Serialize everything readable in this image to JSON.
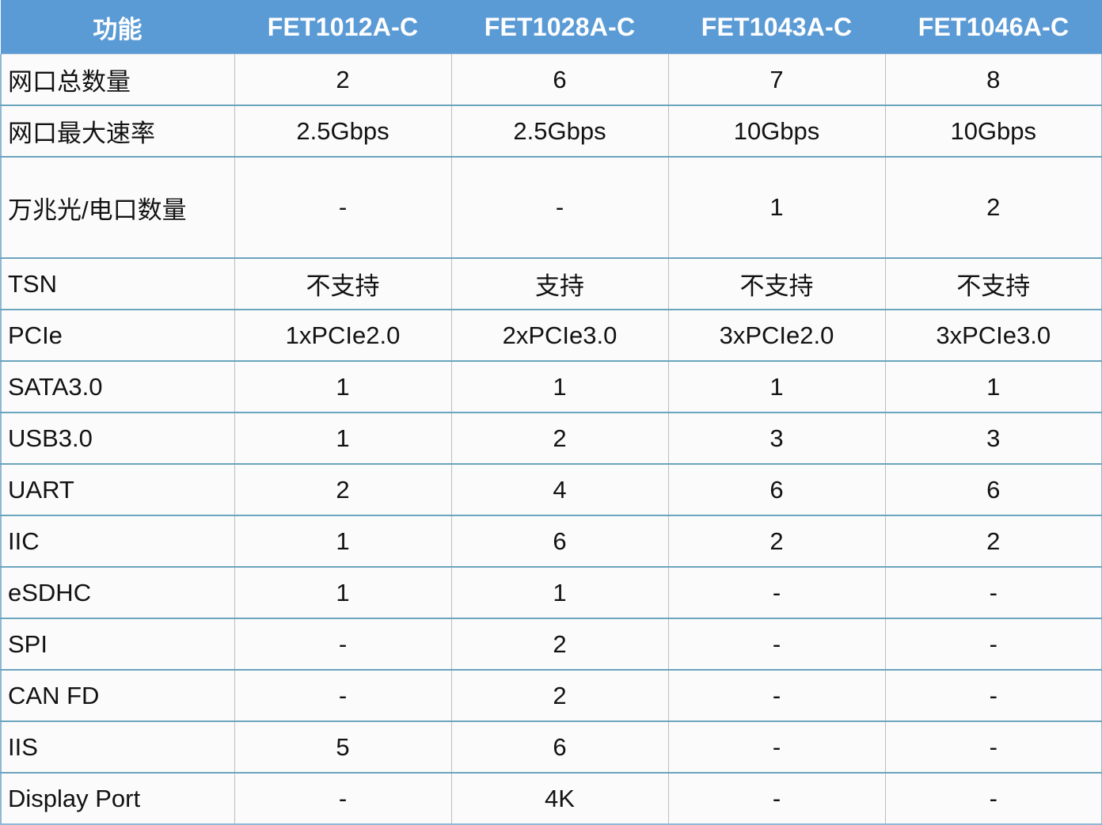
{
  "table": {
    "header": {
      "feature_label": "功能",
      "models": [
        "FET1012A-C",
        "FET1028A-C",
        "FET1043A-C",
        "FET1046A-C"
      ]
    },
    "rows": [
      {
        "feature": "网口总数量",
        "tall": false,
        "values": [
          "2",
          "6",
          "7",
          "8"
        ]
      },
      {
        "feature": "网口最大速率",
        "tall": false,
        "values": [
          "2.5Gbps",
          "2.5Gbps",
          "10Gbps",
          "10Gbps"
        ]
      },
      {
        "feature": "万兆光/电口数量",
        "tall": true,
        "values": [
          "-",
          "-",
          "1",
          "2"
        ]
      },
      {
        "feature": "TSN",
        "tall": false,
        "values": [
          "不支持",
          "支持",
          "不支持",
          "不支持"
        ]
      },
      {
        "feature": "PCIe",
        "tall": false,
        "values": [
          "1xPCIe2.0",
          "2xPCIe3.0",
          "3xPCIe2.0",
          "3xPCIe3.0"
        ]
      },
      {
        "feature": "SATA3.0",
        "tall": false,
        "values": [
          "1",
          "1",
          "1",
          "1"
        ]
      },
      {
        "feature": "USB3.0",
        "tall": false,
        "values": [
          "1",
          "2",
          "3",
          "3"
        ]
      },
      {
        "feature": "UART",
        "tall": false,
        "values": [
          "2",
          "4",
          "6",
          "6"
        ]
      },
      {
        "feature": "IIC",
        "tall": false,
        "values": [
          "1",
          "6",
          "2",
          "2"
        ]
      },
      {
        "feature": "eSDHC",
        "tall": false,
        "values": [
          "1",
          "1",
          "-",
          "-"
        ]
      },
      {
        "feature": "SPI",
        "tall": false,
        "values": [
          "-",
          "2",
          "-",
          "-"
        ]
      },
      {
        "feature": "CAN FD",
        "tall": false,
        "values": [
          "-",
          "2",
          "-",
          "-"
        ]
      },
      {
        "feature": "IIS",
        "tall": false,
        "values": [
          "5",
          "6",
          "-",
          "-"
        ]
      },
      {
        "feature": "Display Port",
        "tall": false,
        "values": [
          "-",
          "4K",
          "-",
          "-"
        ]
      }
    ]
  },
  "colors": {
    "header_blue": "#5b9bd5",
    "row_divider": "#6ba4bd",
    "column_divider": "#b9bdc2",
    "cell_background": "#fbfbfc",
    "text": "#121212",
    "header_text": "#ffffff"
  }
}
